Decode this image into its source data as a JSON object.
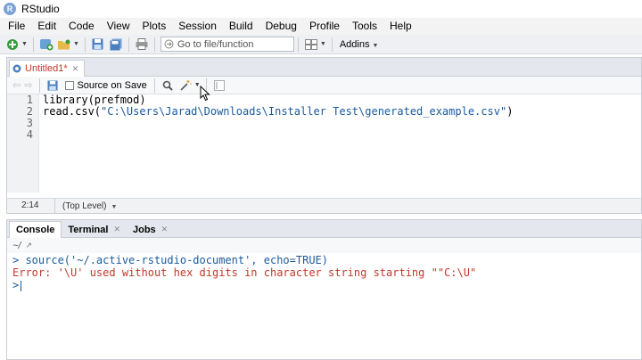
{
  "window": {
    "title": "RStudio",
    "app_icon": "R"
  },
  "menu": [
    "File",
    "Edit",
    "Code",
    "View",
    "Plots",
    "Session",
    "Build",
    "Debug",
    "Profile",
    "Tools",
    "Help"
  ],
  "toolbar": {
    "goto_placeholder": "Go to file/function",
    "addins_label": "Addins"
  },
  "editor": {
    "tab_name": "Untitled1*",
    "source_on_save_label": "Source on Save",
    "line_numbers": [
      "1",
      "2",
      "3",
      "4"
    ],
    "code": {
      "line1": "library(prefmod)",
      "line2_fn": "read.csv(",
      "line2_str": "\"C:\\Users\\Jarad\\Downloads\\Installer Test\\generated_example.csv\"",
      "line2_end": ")"
    },
    "cursor_pos": "2:14",
    "scope": "(Top Level)"
  },
  "console": {
    "tabs": [
      "Console",
      "Terminal",
      "Jobs"
    ],
    "path": "~/",
    "lines": {
      "cmd": "> source('~/.active-rstudio-document', echo=TRUE)",
      "error": "Error: '\\U' used without hex digits in character string starting \"\"C:\\U\"",
      "prompt": ">"
    }
  },
  "colors": {
    "accent": "#1a5a9b",
    "error": "#c0392b",
    "modified_tab": "#c0392b"
  }
}
